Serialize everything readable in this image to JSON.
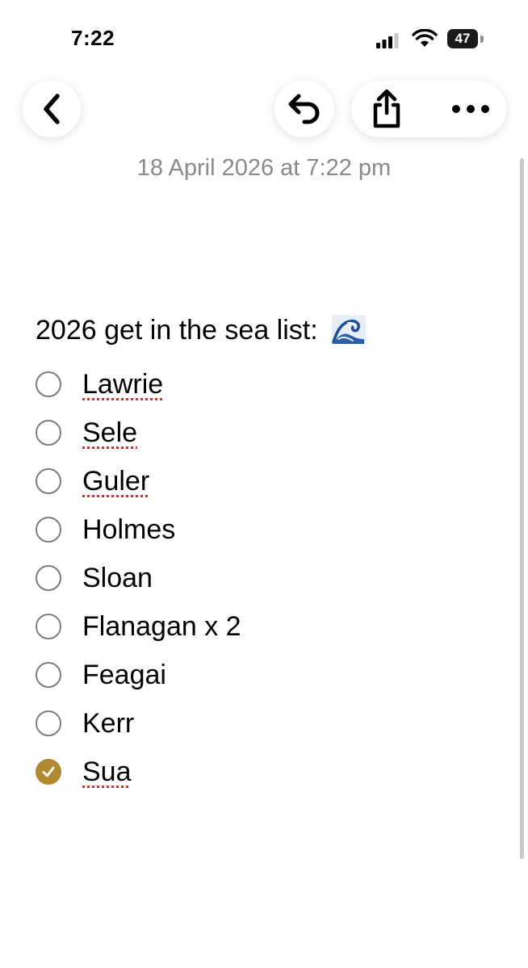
{
  "status_bar": {
    "time": "7:22",
    "battery": "47"
  },
  "toolbar": {
    "back_icon": "chevron-left-icon",
    "undo_icon": "undo-arrow-icon",
    "share_icon": "share-icon",
    "more_icon": "ellipsis-icon"
  },
  "note": {
    "date": "18 April 2026 at 7:22 pm",
    "heading": "2026 get in the sea list:",
    "heading_emoji": "wave-icon",
    "items": [
      {
        "label": "Lawrie",
        "checked": false,
        "misspelled": true
      },
      {
        "label": "Sele",
        "checked": false,
        "misspelled": true
      },
      {
        "label": "Guler",
        "checked": false,
        "misspelled": true
      },
      {
        "label": "Holmes",
        "checked": false,
        "misspelled": false
      },
      {
        "label": "Sloan",
        "checked": false,
        "misspelled": false
      },
      {
        "label": "Flanagan x 2",
        "checked": false,
        "misspelled": false
      },
      {
        "label": "Feagai",
        "checked": false,
        "misspelled": false
      },
      {
        "label": "Kerr",
        "checked": false,
        "misspelled": false
      },
      {
        "label": "Sua",
        "checked": true,
        "misspelled": true
      }
    ]
  },
  "colors": {
    "check_accent": "#b18a2f",
    "date_gray": "#8a8a8e",
    "spell_underline": "#d0342c"
  }
}
